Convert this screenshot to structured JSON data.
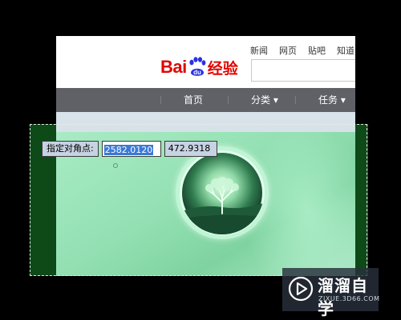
{
  "baidu": {
    "top_links": [
      "新闻",
      "网页",
      "贴吧",
      "知道"
    ],
    "logo_text_bai": "Bai",
    "logo_text_du": "du",
    "logo_text_jingyan": "经验",
    "nav_items": [
      {
        "label": "首页"
      },
      {
        "label": "分类 ▾"
      },
      {
        "label": "任务 ▾"
      }
    ]
  },
  "prompt": {
    "label": "指定对角点:",
    "x_value": "2582.0120",
    "y_value": "472.9318"
  },
  "watermark": {
    "title": "溜溜自学",
    "url": "ZIXUE.3D66.COM"
  },
  "colors": {
    "baidu_red": "#e10601",
    "nav_bar": "#606167",
    "selection_highlight": "#3b79d6",
    "banner_green": "#93e0b3",
    "dark_green": "#0d4a18"
  }
}
